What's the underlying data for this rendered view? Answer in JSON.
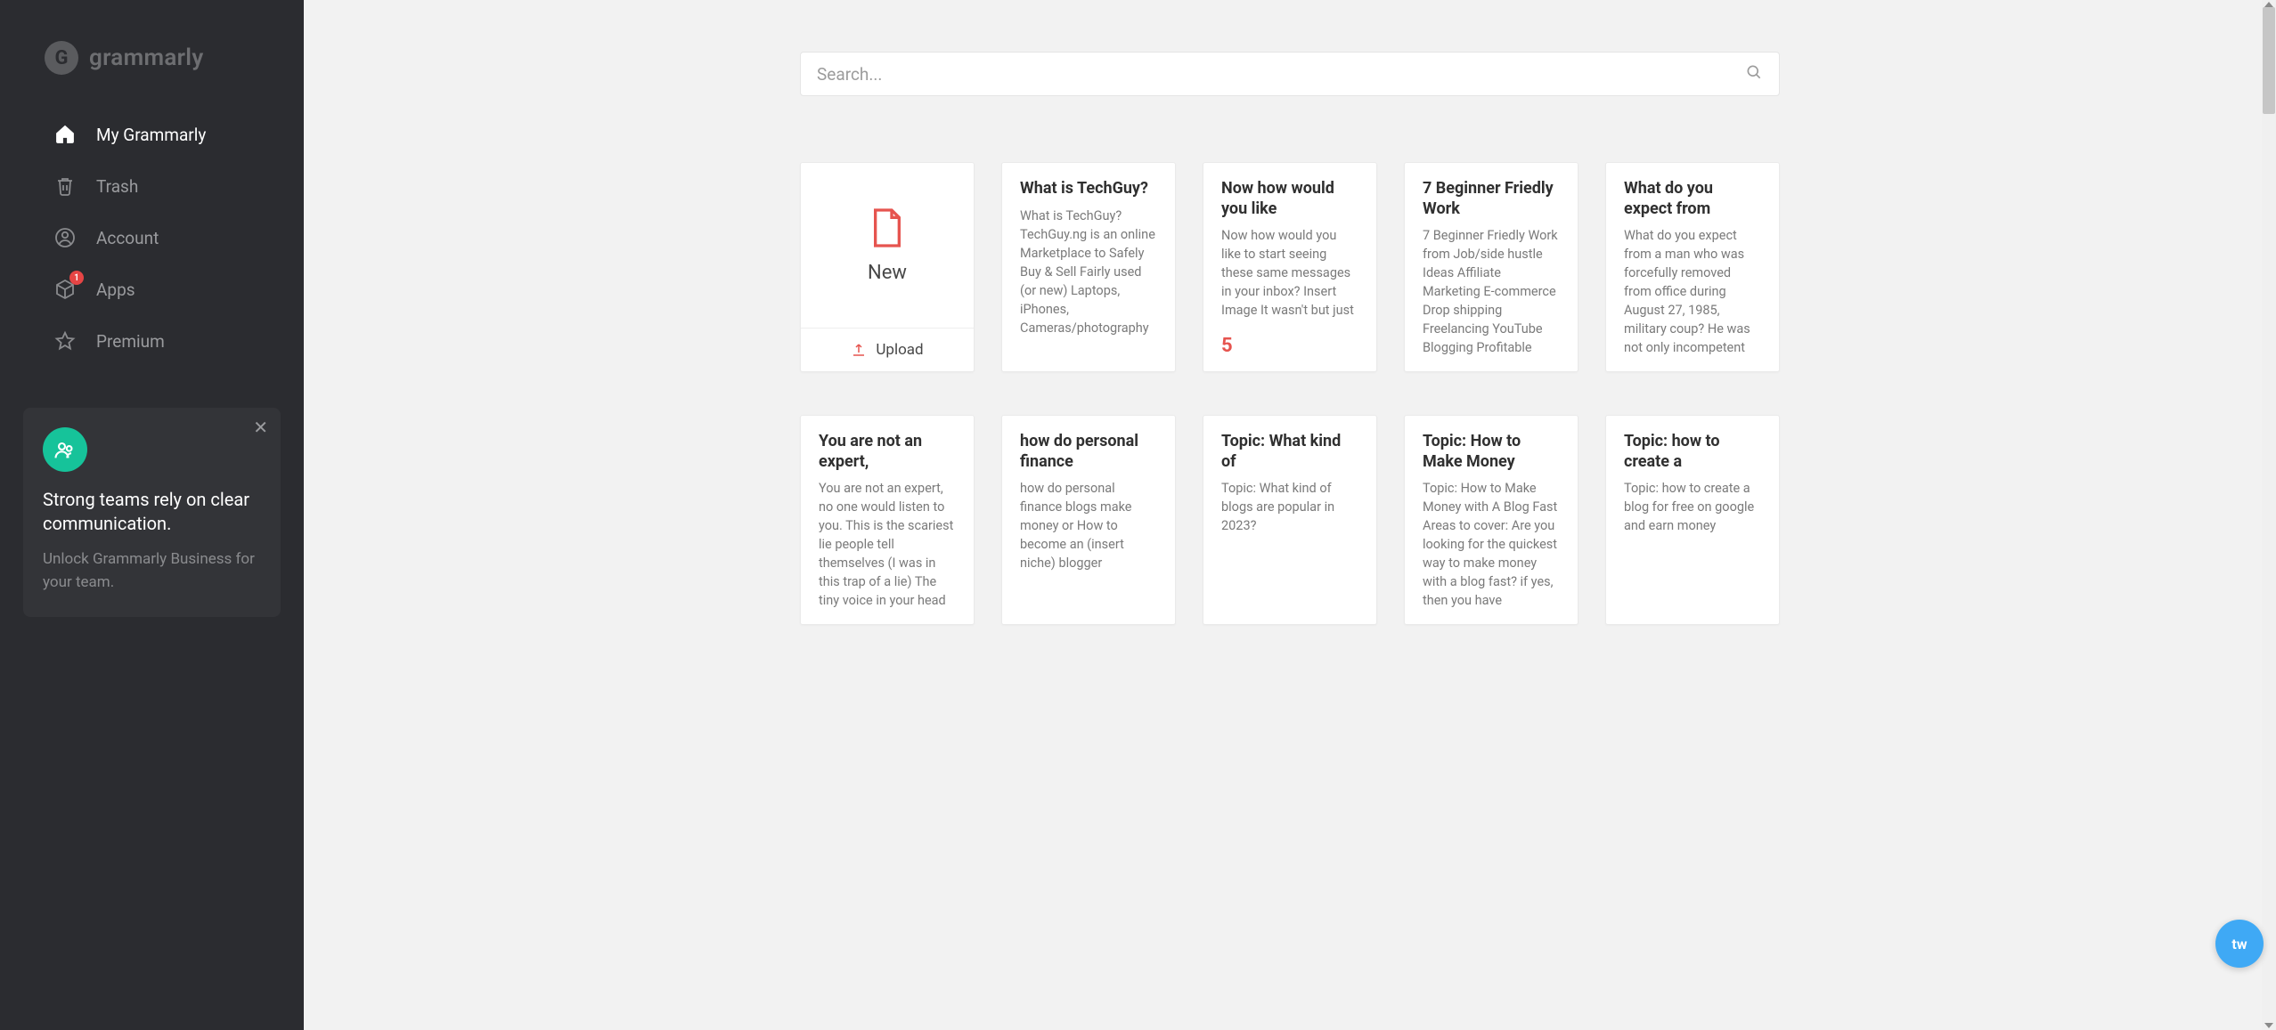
{
  "brand": {
    "name": "grammarly",
    "glyph": "G"
  },
  "sidebar": {
    "items": [
      {
        "label": "My Grammarly",
        "icon": "home-icon",
        "active": true
      },
      {
        "label": "Trash",
        "icon": "trash-icon",
        "active": false
      },
      {
        "label": "Account",
        "icon": "user-icon",
        "active": false
      },
      {
        "label": "Apps",
        "icon": "apps-icon",
        "active": false,
        "badge": "1"
      },
      {
        "label": "Premium",
        "icon": "star-icon",
        "active": false
      }
    ]
  },
  "promo": {
    "title": "Strong teams rely on clear communication.",
    "subtitle": "Unlock Grammarly Business for your team."
  },
  "search": {
    "placeholder": "Search..."
  },
  "new_card": {
    "label": "New",
    "upload_label": "Upload"
  },
  "docs": [
    {
      "title": "What is TechGuy?",
      "preview": "What is TechGuy? TechGuy.ng is an online Marketplace to Safely Buy & Sell Fairly used (or new) Laptops, iPhones, Cameras/photography",
      "score": null
    },
    {
      "title": "Now how would you like",
      "preview": "Now how would you like to start seeing these same messages in your inbox? Insert Image It wasn't but just",
      "score": "5"
    },
    {
      "title": "7 Beginner Friedly Work",
      "preview": "7 Beginner Friedly Work from Job/side hustle Ideas Affiliate Marketing E-commerce Drop shipping Freelancing YouTube Blogging Profitable",
      "score": null
    },
    {
      "title": "What do you expect from",
      "preview": "What do you expect from a man who was forcefully removed from office during August 27, 1985, military coup? He was not only incompetent",
      "score": null
    },
    {
      "title": "You are not an expert,",
      "preview": "You are not an expert, no one would listen to you. This is the scariest lie people tell themselves (I was in this trap of a lie) The tiny voice in your head",
      "score": null
    },
    {
      "title": "how do personal finance",
      "preview": "how do personal finance blogs make money or How to become an (insert niche) blogger",
      "score": null
    },
    {
      "title": "Topic: What kind of",
      "preview": "Topic: What kind of blogs are popular in 2023?",
      "score": null
    },
    {
      "title": "Topic: How to Make Money",
      "preview": "Topic: How to Make Money with A Blog Fast Areas to cover: Are you looking for the quickest way to make money with a blog fast? if yes, then you have",
      "score": null
    },
    {
      "title": "Topic: how to create a",
      "preview": "Topic: how to create a blog for free on google and earn money",
      "score": null
    }
  ],
  "widget": {
    "label": "tw"
  }
}
